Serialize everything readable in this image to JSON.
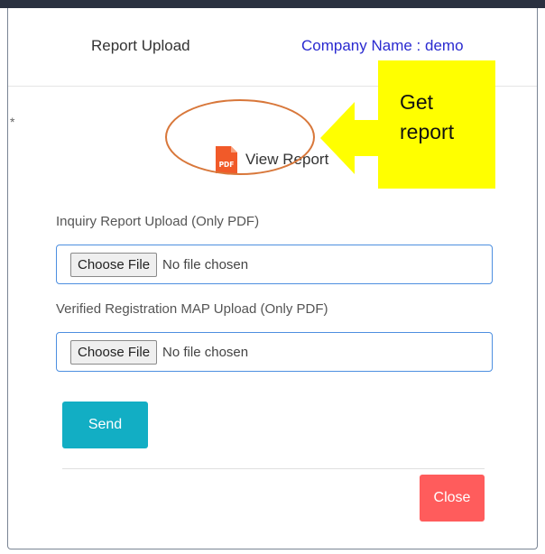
{
  "modal": {
    "title": "Report Upload",
    "company_label": "Company Name : demo",
    "required_mark": "*"
  },
  "view_report": {
    "label": "View Report",
    "icon": "pdf-file-icon",
    "icon_text": "PDF"
  },
  "annotation": {
    "text_line1": "Get",
    "text_line2": "report",
    "highlight_color": "#ffff00",
    "ellipse_color": "#d8773a"
  },
  "fields": [
    {
      "label": "Inquiry Report Upload (Only PDF)",
      "button_label": "Choose File",
      "status": "No file chosen"
    },
    {
      "label": "Verified Registration MAP Upload (Only PDF)",
      "button_label": "Choose File",
      "status": "No file chosen"
    }
  ],
  "buttons": {
    "send": "Send",
    "close": "Close"
  },
  "colors": {
    "company_text": "#2a2ad0",
    "send_button": "#12aec4",
    "close_button": "#ff5c5c",
    "field_border": "#4d8fe0"
  }
}
